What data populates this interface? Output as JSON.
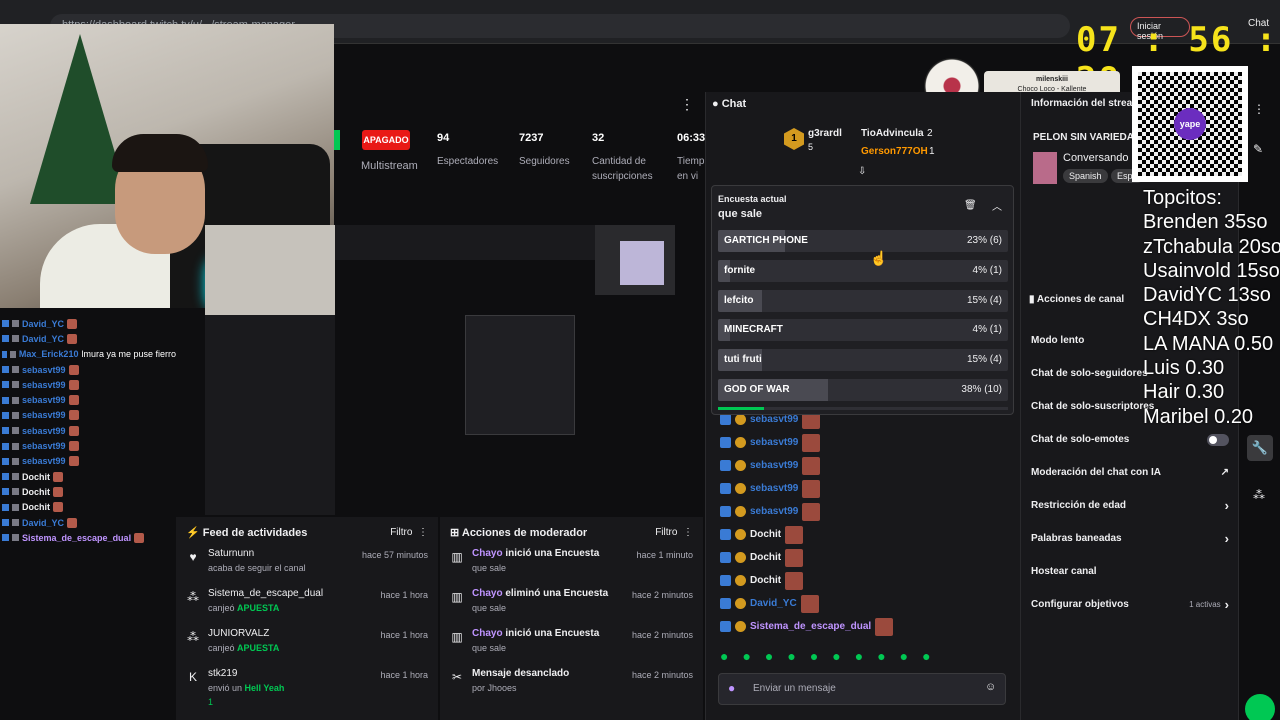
{
  "browser": {
    "url": "https://dashboard.twitch.tv/u/.../stream-manager",
    "signin": "Iniciar sesión",
    "chat_label": "Chat"
  },
  "clock": "07 : 56 : 28",
  "now_playing": {
    "user": "milenskiii",
    "track": "Choco Loco - Kallente"
  },
  "left_chat": [
    {
      "user": "David_YC",
      "color": "#3a7bd5"
    },
    {
      "user": "David_YC",
      "color": "#3a7bd5"
    },
    {
      "user": "Max_Erick210",
      "color": "#3a7bd5",
      "text": "lmura ya me puse fierro"
    },
    {
      "user": "sebasvt99",
      "color": "#3a7bd5"
    },
    {
      "user": "sebasvt99",
      "color": "#3a7bd5"
    },
    {
      "user": "sebasvt99",
      "color": "#3a7bd5"
    },
    {
      "user": "sebasvt99",
      "color": "#3a7bd5"
    },
    {
      "user": "sebasvt99",
      "color": "#3a7bd5"
    },
    {
      "user": "sebasvt99",
      "color": "#3a7bd5"
    },
    {
      "user": "sebasvt99",
      "color": "#3a7bd5"
    },
    {
      "user": "Dochit",
      "color": "#efeff1"
    },
    {
      "user": "Dochit",
      "color": "#efeff1"
    },
    {
      "user": "Dochit",
      "color": "#efeff1"
    },
    {
      "user": "David_YC",
      "color": "#3a7bd5"
    },
    {
      "user": "Sistema_de_escape_dual",
      "color": "#bf94ff"
    }
  ],
  "stats": {
    "status": "APAGADO",
    "multistream": "Multistream",
    "viewers": "94",
    "viewers_label": "Espectadores",
    "followers": "7237",
    "followers_label": "Seguidores",
    "subs": "32",
    "subs_label1": "Cantidad de",
    "subs_label2": "suscripciones",
    "time": "06:33",
    "time_label1": "Tiemp",
    "time_label2": "en vi"
  },
  "feed": {
    "title": "Feed de actividades",
    "filter": "Filtro",
    "items": [
      {
        "name": "Saturnunn",
        "sub": "acaba de seguir el canal",
        "time": "hace 57 minutos",
        "icon": "♥"
      },
      {
        "name": "Sistema_de_escape_dual",
        "sub_pre": "canjeó ",
        "sub_hl": "APUESTA",
        "time": "hace 1 hora",
        "icon": "⁂"
      },
      {
        "name": "JUNIORVALZ",
        "sub_pre": "canjeó ",
        "sub_hl": "APUESTA",
        "time": "hace 1 hora",
        "icon": "⁂"
      },
      {
        "name": "stk219",
        "sub_pre": "envió un ",
        "sub_hl": "Hell Yeah",
        "time": "hace 1 hora",
        "icon": "K",
        "extra": "1"
      }
    ]
  },
  "mod": {
    "title": "Acciones de moderador",
    "filter": "Filtro",
    "items": [
      {
        "who": "Chayo",
        "action": " inició una Encuesta",
        "sub": "que sale",
        "time": "hace 1 minuto"
      },
      {
        "who": "Chayo",
        "action": " eliminó una Encuesta",
        "sub": "que sale",
        "time": "hace 2 minutos"
      },
      {
        "who": "Chayo",
        "action": " inició una Encuesta",
        "sub": "que sale",
        "time": "hace 2 minutos"
      },
      {
        "who": "",
        "action": "Mensaje desanclado",
        "sub": "por Jhooes",
        "time": "hace 2 minutos"
      }
    ]
  },
  "chat": {
    "title": "Chat",
    "leaders": [
      {
        "rank": "1",
        "user": "g3rardl",
        "count": "5"
      },
      {
        "user": "TioAdvincula",
        "count": "2"
      },
      {
        "user": "Gerson777OH",
        "count": "1"
      }
    ],
    "poll": {
      "label": "Encuesta actual",
      "question": "que sale",
      "options": [
        {
          "name": "GARTICH PHONE",
          "percent": 23,
          "display": "23% (6)"
        },
        {
          "name": "fornite",
          "percent": 4,
          "display": "4% (1)"
        },
        {
          "name": "lefcito",
          "percent": 15,
          "display": "15% (4)"
        },
        {
          "name": "MINECRAFT",
          "percent": 4,
          "display": "4% (1)"
        },
        {
          "name": "tuti fruti",
          "percent": 15,
          "display": "15% (4)"
        },
        {
          "name": "GOD OF WAR",
          "percent": 38,
          "display": "38% (10)"
        }
      ],
      "progress": 0.16
    },
    "messages": [
      {
        "user": "sebasvt99",
        "color": "#3a7bd5"
      },
      {
        "user": "sebasvt99",
        "color": "#3a7bd5"
      },
      {
        "user": "sebasvt99",
        "color": "#3a7bd5"
      },
      {
        "user": "sebasvt99",
        "color": "#3a7bd5"
      },
      {
        "user": "sebasvt99",
        "color": "#3a7bd5"
      },
      {
        "user": "Dochit",
        "color": "#efeff1"
      },
      {
        "user": "Dochit",
        "color": "#efeff1"
      },
      {
        "user": "Dochit",
        "color": "#efeff1"
      },
      {
        "user": "David_YC",
        "color": "#3a7bd5"
      },
      {
        "user": "Sistema_de_escape_dual",
        "color": "#bf94ff"
      }
    ],
    "placeholder": "Enviar un mensaje"
  },
  "right_panel": {
    "info_title": "Información del stream",
    "stream_title": "PELON SIN VARIEDAD",
    "category": "Conversando",
    "tags": [
      "Spanish",
      "Espa"
    ],
    "actions_title": "Acciones de canal",
    "actions": [
      {
        "label": "Modo lento",
        "type": "none"
      },
      {
        "label": "Chat de solo-seguidores",
        "type": "none"
      },
      {
        "label": "Chat de solo-suscriptores",
        "type": "none"
      },
      {
        "label": "Chat de solo-emotes",
        "type": "toggle"
      },
      {
        "label": "Moderación del chat con IA",
        "type": "ext"
      },
      {
        "label": "Restricción de edad",
        "type": "arrow"
      },
      {
        "label": "Palabras baneadas",
        "type": "arrow"
      },
      {
        "label": "Hostear canal",
        "type": "none"
      },
      {
        "label": "Configurar objetivos",
        "type": "arrow",
        "note": "1 activas"
      }
    ]
  },
  "overlay": {
    "qr_label": "yape",
    "top_title": "Topcitos:",
    "top": [
      "Brenden 35so",
      "zTchabula 20so",
      "Usainvold 15so",
      "DavidYC 13so",
      "CH4DX 3so",
      "LA MANA 0.50",
      "Luis 0.30",
      "Hair 0.30",
      "Maribel 0.20"
    ]
  }
}
